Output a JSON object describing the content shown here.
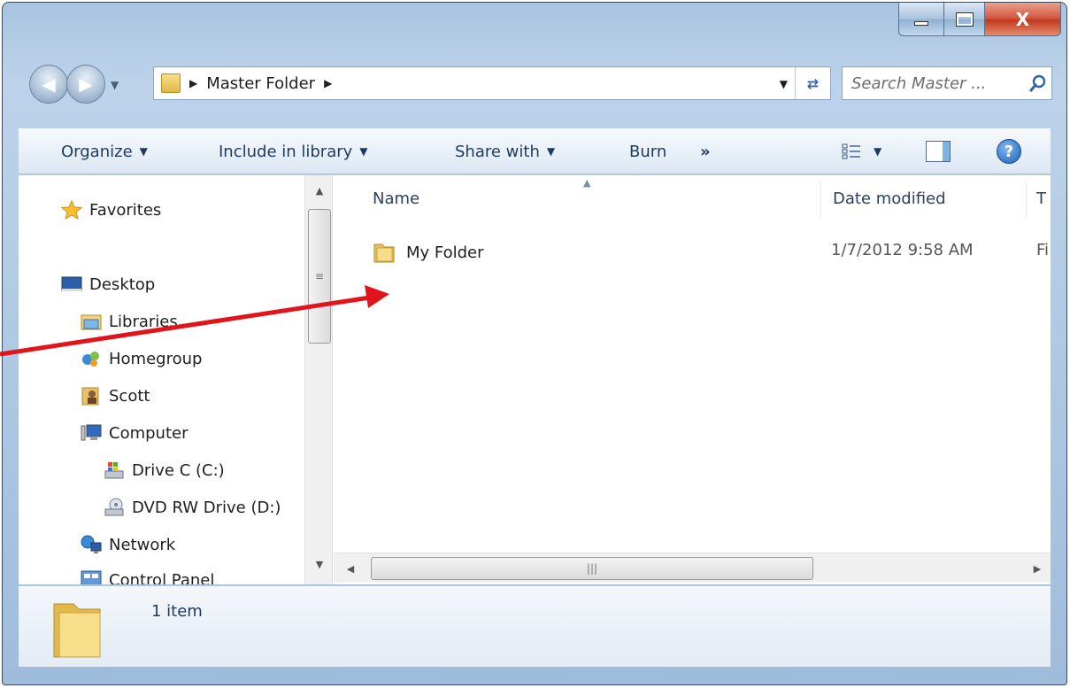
{
  "window": {
    "caption_buttons": {
      "minimize": "minimize",
      "maximize": "maximize",
      "close_label": "X"
    }
  },
  "address": {
    "path_segment": "Master Folder",
    "search_placeholder": "Search Master ..."
  },
  "toolbar": {
    "organize": "Organize",
    "include_in_library": "Include in library",
    "share_with": "Share with",
    "burn": "Burn",
    "more": "»"
  },
  "sidebar": {
    "items": [
      {
        "label": "Favorites",
        "icon": "star-icon"
      },
      {
        "label": "Desktop",
        "icon": "desktop-icon"
      },
      {
        "label": "Libraries",
        "icon": "libraries-icon"
      },
      {
        "label": "Homegroup",
        "icon": "homegroup-icon"
      },
      {
        "label": "Scott",
        "icon": "user-folder-icon"
      },
      {
        "label": "Computer",
        "icon": "computer-icon"
      },
      {
        "label": "Drive C (C:)",
        "icon": "drive-icon"
      },
      {
        "label": "DVD RW Drive (D:)",
        "icon": "dvd-drive-icon"
      },
      {
        "label": "Network",
        "icon": "network-icon"
      },
      {
        "label": "Control Panel",
        "icon": "control-panel-icon"
      }
    ]
  },
  "file_list": {
    "columns": [
      "Name",
      "Date modified",
      "T"
    ],
    "rows": [
      {
        "name": "My Folder",
        "date_modified": "1/7/2012 9:58 AM",
        "type": "Fi"
      }
    ]
  },
  "status": {
    "item_count": "1 item"
  },
  "colors": {
    "annotation_arrow": "#e0141a",
    "window_frame": "#a9c4e0",
    "close_button": "#c1361a"
  }
}
